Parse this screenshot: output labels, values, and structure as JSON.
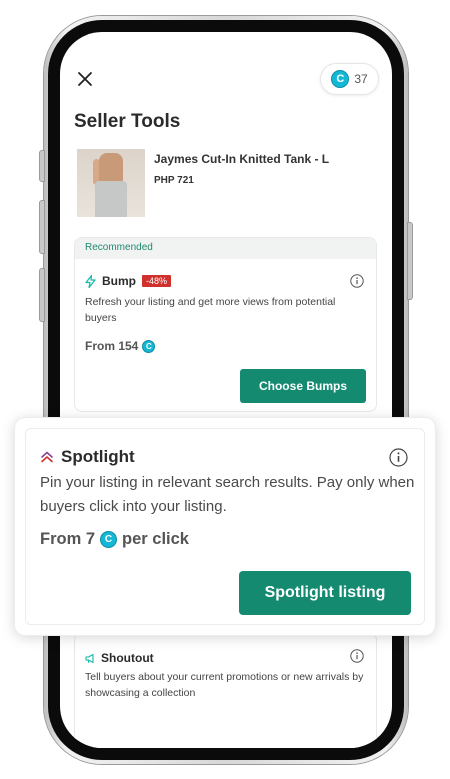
{
  "header": {
    "coin_symbol": "C",
    "coin_balance": "37",
    "title": "Seller Tools"
  },
  "product": {
    "name": "Jaymes Cut-In Knitted Tank - L",
    "price": "PHP 721"
  },
  "bump": {
    "recommended_label": "Recommended",
    "title": "Bump",
    "discount": "-48%",
    "description": "Refresh your listing and get more views from potential buyers",
    "price_prefix": "From 154",
    "button_label": "Choose Bumps"
  },
  "spotlight": {
    "title": "Spotlight",
    "description": "Pin your listing in relevant search results. Pay only when buyers click into your listing.",
    "price_prefix": "From 7",
    "price_suffix": "per click",
    "button_label": "Spotlight listing"
  },
  "shoutout": {
    "title": "Shoutout",
    "description": "Tell buyers about your current promotions or new arrivals by showcasing a collection"
  },
  "colors": {
    "accent_green": "#148a71",
    "coin_blue": "#14b8d6",
    "discount_red": "#d0312d",
    "recommended_text": "#1f8a70",
    "spotlight_icon": "#8e3f9e"
  },
  "icons": {
    "close": "close-icon",
    "coin": "coin-icon",
    "bump": "lightning-bolt-icon",
    "spotlight": "double-chevron-up-icon",
    "shoutout": "megaphone-icon",
    "info": "info-icon"
  }
}
